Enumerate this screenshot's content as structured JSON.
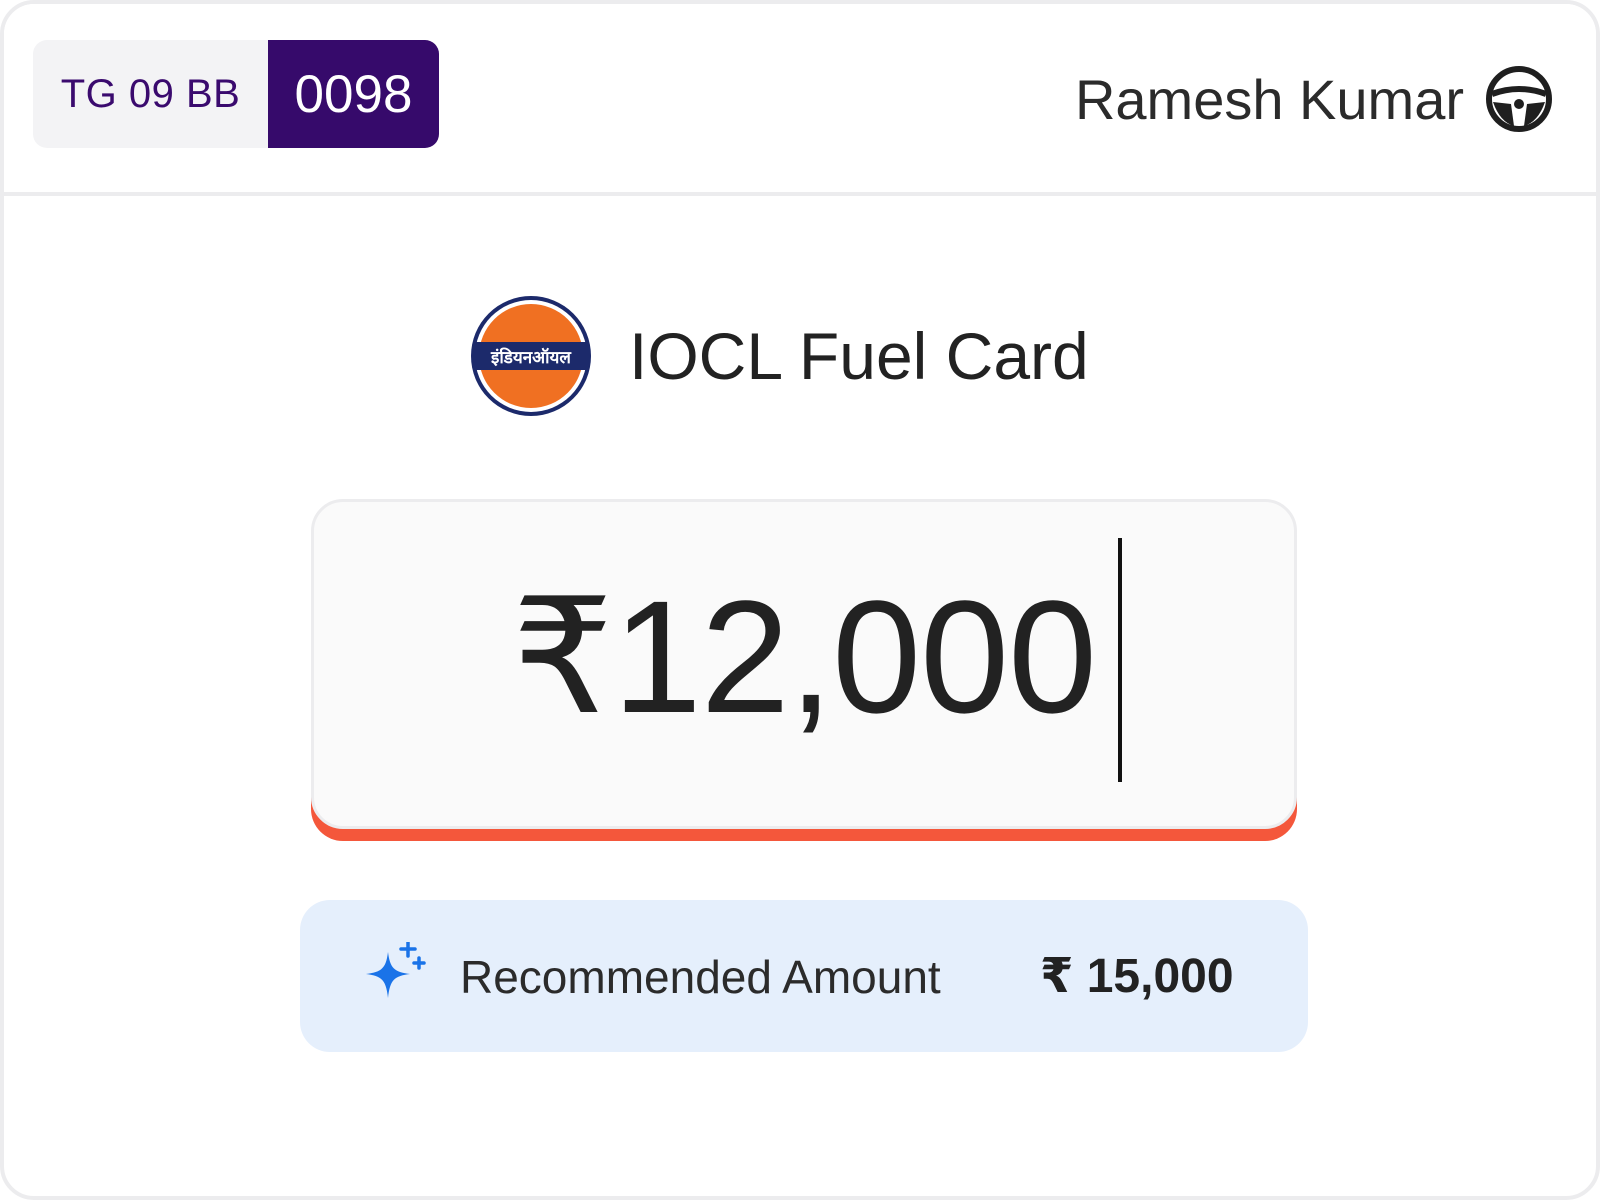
{
  "vehicle": {
    "plate_prefix": "TG 09 BB",
    "plate_number": "0098"
  },
  "driver": {
    "name": "Ramesh Kumar",
    "icon": "steering-wheel-icon"
  },
  "fuel_card": {
    "title": "IOCL Fuel Card",
    "logo_text": "इंडियनऑयल",
    "logo_icon": "indian-oil-logo"
  },
  "amount_input": {
    "value": "₹12,000"
  },
  "recommendation": {
    "icon": "sparkle-icon",
    "label": "Recommended Amount",
    "value": "₹ 15,000"
  },
  "colors": {
    "plate_accent": "#360a6b",
    "input_underline": "#f4573b",
    "recommend_bg": "#e5effc",
    "sparkle": "#1a73e8",
    "logo_orange": "#f07022",
    "logo_navy": "#1c2a6b"
  }
}
